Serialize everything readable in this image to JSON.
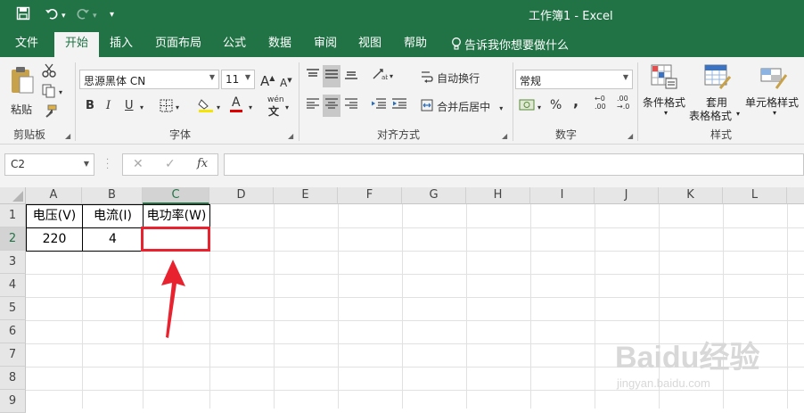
{
  "window": {
    "title": "工作簿1  -  Excel"
  },
  "qat": {
    "save_icon": "save-icon",
    "undo_icon": "undo-icon",
    "redo_icon": "redo-icon",
    "customize_icon": "customize-icon"
  },
  "tabs": [
    "文件",
    "开始",
    "插入",
    "页面布局",
    "公式",
    "数据",
    "审阅",
    "视图",
    "帮助"
  ],
  "tell_me": "告诉我你想要做什么",
  "ribbon": {
    "clipboard": {
      "paste_label": "粘贴",
      "group_label": "剪贴板"
    },
    "font": {
      "font_name": "思源黑体 CN",
      "font_size": "11",
      "bold": "B",
      "italic": "I",
      "underline": "U",
      "phonetic": "wén",
      "font_color": "A",
      "group_label": "字体",
      "grow": "A",
      "shrink": "A"
    },
    "alignment": {
      "wrap_label": "自动换行",
      "merge_label": "合并后居中",
      "group_label": "对齐方式"
    },
    "number": {
      "format": "常规",
      "percent": "%",
      "comma": ",",
      "inc_decimal": ".00",
      "dec_decimal": ".00",
      "group_label": "数字"
    },
    "styles": {
      "conditional_label": "条件格式",
      "table_label_1": "套用",
      "table_label_2": "表格格式",
      "cell_styles_label": "单元格样式",
      "group_label": "样式"
    }
  },
  "formula_bar": {
    "name_box": "C2",
    "fx": "fx",
    "formula": ""
  },
  "columns": [
    "A",
    "B",
    "C",
    "D",
    "E",
    "F",
    "G",
    "H",
    "I",
    "J",
    "K",
    "L"
  ],
  "rows": [
    "1",
    "2",
    "3",
    "4",
    "5",
    "6",
    "7",
    "8",
    "9"
  ],
  "cells": {
    "A1": "电压(V)",
    "B1": "电流(I)",
    "C1": "电功率(W)",
    "A2": "220",
    "B2": "4",
    "C2": ""
  },
  "watermark": {
    "brand": "Baidu经验",
    "url": "jingyan.baidu.com"
  },
  "colors": {
    "excel_green": "#217346",
    "annotation_red": "#e8232f"
  }
}
